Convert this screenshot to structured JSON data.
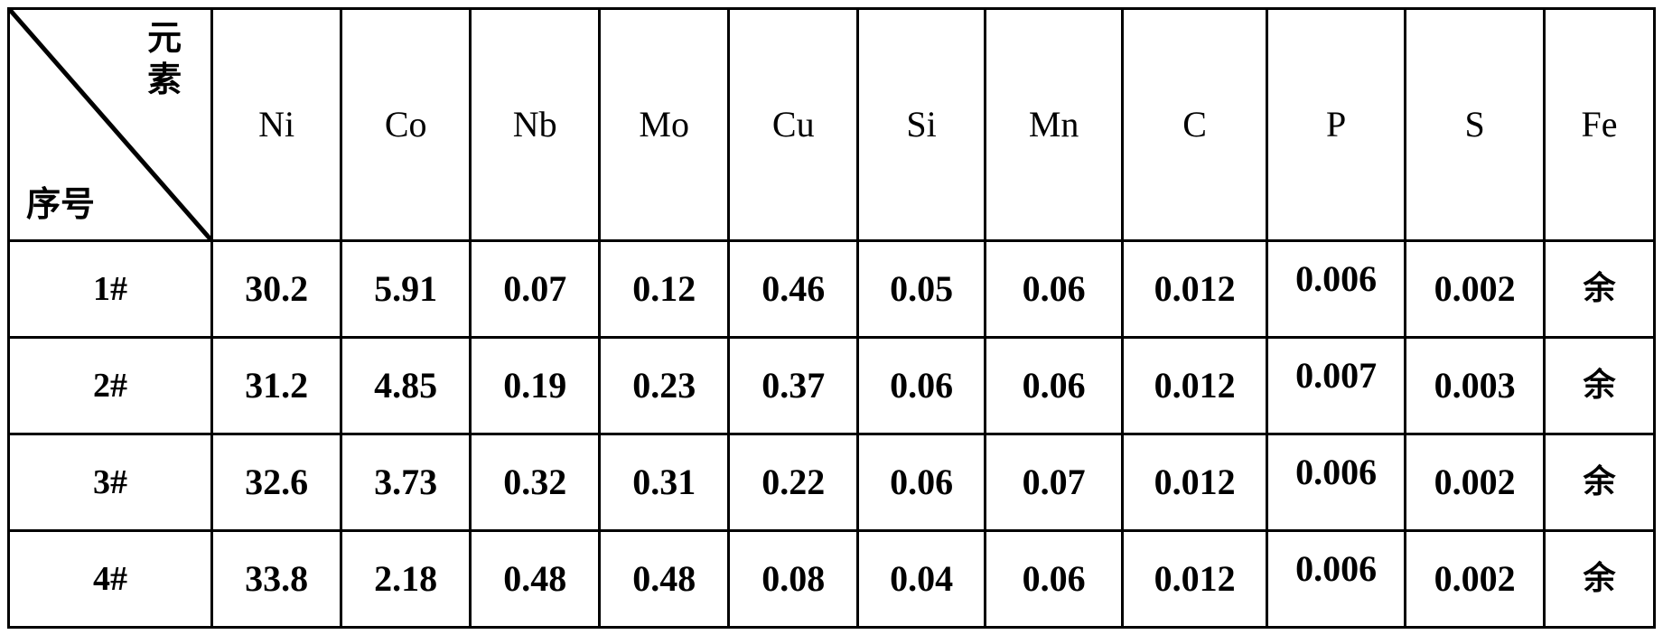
{
  "document": {
    "type": "table",
    "background_color": "#ffffff",
    "text_color": "#000000",
    "border_color": "#000000"
  },
  "table": {
    "stub": {
      "column_axis_label": "元\n素",
      "row_axis_label": "序号",
      "diagonal_divider": true
    },
    "columns": [
      "Ni",
      "Co",
      "Nb",
      "Mo",
      "Cu",
      "Si",
      "Mn",
      "C",
      "P",
      "S",
      "Fe"
    ],
    "rows": [
      {
        "label": "1#",
        "values": [
          "30.2",
          "5.91",
          "0.07",
          "0.12",
          "0.46",
          "0.05",
          "0.06",
          "0.012",
          "0.006",
          "0.002",
          "余"
        ]
      },
      {
        "label": "2#",
        "values": [
          "31.2",
          "4.85",
          "0.19",
          "0.23",
          "0.37",
          "0.06",
          "0.06",
          "0.012",
          "0.007",
          "0.003",
          "余"
        ]
      },
      {
        "label": "3#",
        "values": [
          "32.6",
          "3.73",
          "0.32",
          "0.31",
          "0.22",
          "0.06",
          "0.07",
          "0.012",
          "0.006",
          "0.002",
          "余"
        ]
      },
      {
        "label": "4#",
        "values": [
          "33.8",
          "2.18",
          "0.48",
          "0.48",
          "0.08",
          "0.04",
          "0.06",
          "0.012",
          "0.006",
          "0.002",
          "余"
        ]
      }
    ]
  }
}
